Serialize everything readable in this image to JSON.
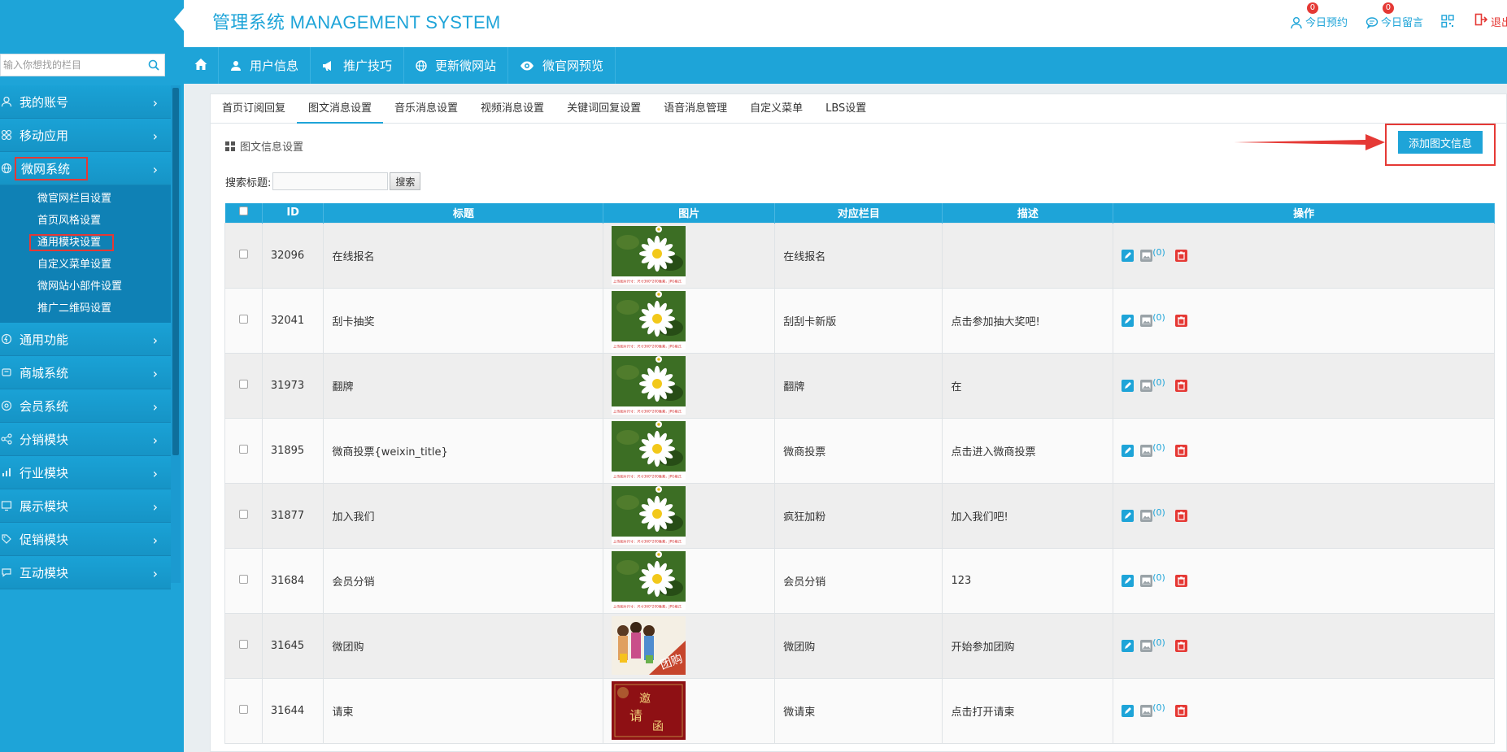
{
  "app": {
    "brand": "管理系统 MANAGEMENT SYSTEM"
  },
  "header": {
    "appointments": {
      "label": "今日预约",
      "badge": "0"
    },
    "messages": {
      "label": "今日留言",
      "badge": "0"
    },
    "logout": "退出"
  },
  "sidebar": {
    "search_placeholder": "输入你想找的栏目",
    "items": [
      {
        "label": "我的账号",
        "icon": "user-icon"
      },
      {
        "label": "移动应用",
        "icon": "apps-icon"
      },
      {
        "label": "微网系统",
        "icon": "globe-icon",
        "active": true
      },
      {
        "label": "通用功能",
        "icon": "bolt-icon"
      },
      {
        "label": "商城系统",
        "icon": "cart-icon"
      },
      {
        "label": "会员系统",
        "icon": "member-icon"
      },
      {
        "label": "分销模块",
        "icon": "share-icon"
      },
      {
        "label": "行业模块",
        "icon": "chart-icon"
      },
      {
        "label": "展示模块",
        "icon": "monitor-icon"
      },
      {
        "label": "促销模块",
        "icon": "tag-icon"
      },
      {
        "label": "互动模块",
        "icon": "chat-icon"
      }
    ],
    "sub_items": [
      "微官网栏目设置",
      "首页风格设置",
      "通用模块设置",
      "自定义菜单设置",
      "微网站小部件设置",
      "推广二维码设置"
    ]
  },
  "topnav": [
    "用户信息",
    "推广技巧",
    "更新微网站",
    "微官网预览"
  ],
  "tabs": [
    "首页订阅回复",
    "图文消息设置",
    "音乐消息设置",
    "视频消息设置",
    "关键词回复设置",
    "语音消息管理",
    "自定义菜单",
    "LBS设置"
  ],
  "section": {
    "title": "图文信息设置",
    "add_button": "添加图文信息",
    "search_label": "搜索标题:",
    "search_button": "搜索"
  },
  "table": {
    "headers": [
      "ID",
      "标题",
      "图片",
      "对应栏目",
      "描述",
      "操作"
    ],
    "rows": [
      {
        "id": "32096",
        "title": "在线报名",
        "image": "daisy",
        "column": "在线报名",
        "desc": "",
        "count": "(0)"
      },
      {
        "id": "32041",
        "title": "刮卡抽奖",
        "image": "daisy",
        "column": "刮刮卡新版",
        "desc": "点击参加抽大奖吧!",
        "count": "(0)"
      },
      {
        "id": "31973",
        "title": "翻牌",
        "image": "daisy",
        "column": "翻牌",
        "desc": "在",
        "count": "(0)"
      },
      {
        "id": "31895",
        "title": "微商投票{weixin_title}",
        "image": "daisy",
        "column": "微商投票",
        "desc": "点击进入微商投票",
        "count": "(0)"
      },
      {
        "id": "31877",
        "title": "加入我们",
        "image": "daisy",
        "column": "疯狂加粉",
        "desc": "加入我们吧!",
        "count": "(0)"
      },
      {
        "id": "31684",
        "title": "会员分销",
        "image": "daisy",
        "column": "会员分销",
        "desc": "123",
        "count": "(0)"
      },
      {
        "id": "31645",
        "title": "微团购",
        "image": "groupbuy",
        "column": "微团购",
        "desc": "开始参加团购",
        "count": "(0)"
      },
      {
        "id": "31644",
        "title": "请柬",
        "image": "invitation",
        "column": "微请柬",
        "desc": "点击打开请柬",
        "count": "(0)"
      }
    ],
    "thumb_caption": "上传图片尺寸：尺寸360*200像素，JPG格式",
    "groupbuy_text": "团购",
    "invite_text": "邀请函"
  },
  "colors": {
    "accent": "#1ea4d8",
    "highlight": "#e53935"
  }
}
